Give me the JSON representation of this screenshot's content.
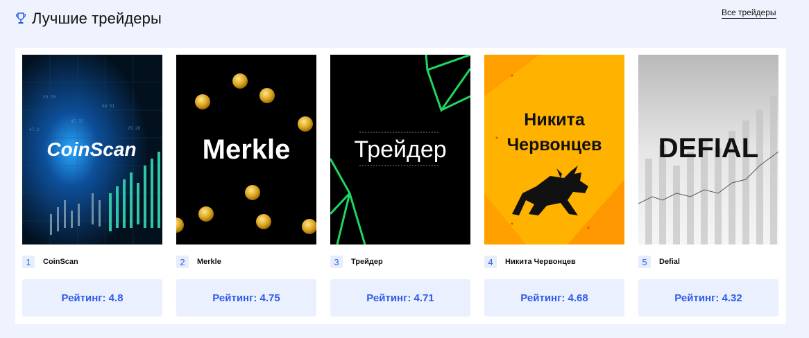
{
  "header": {
    "title": "Лучшие трейдеры",
    "all_link": "Все трейдеры",
    "icon": "trophy-icon"
  },
  "colors": {
    "accent": "#2f5bea",
    "rank_bg": "#e6eefc",
    "rating_bg": "#eaf0fd",
    "page_bg": "#eef3fd"
  },
  "traders": [
    {
      "rank": "1",
      "name": "CoinScan",
      "rating": "Рейтинг: 4.8",
      "logo_text": "CoinScan",
      "chart_numbers": [
        "59.70",
        "64.51",
        "47.35",
        "29.28",
        "47.2"
      ]
    },
    {
      "rank": "2",
      "name": "Merkle",
      "rating": "Рейтинг: 4.75",
      "logo_text": "Merkle"
    },
    {
      "rank": "3",
      "name": "Трейдер",
      "rating": "Рейтинг: 4.71",
      "logo_text": "Трейдер"
    },
    {
      "rank": "4",
      "name": "Никита Червонцев",
      "rating": "Рейтинг: 4.68",
      "logo_text": [
        "Никита",
        "Червонцев"
      ]
    },
    {
      "rank": "5",
      "name": "Defial",
      "rating": "Рейтинг: 4.32",
      "logo_text": "DEFIAL"
    }
  ]
}
